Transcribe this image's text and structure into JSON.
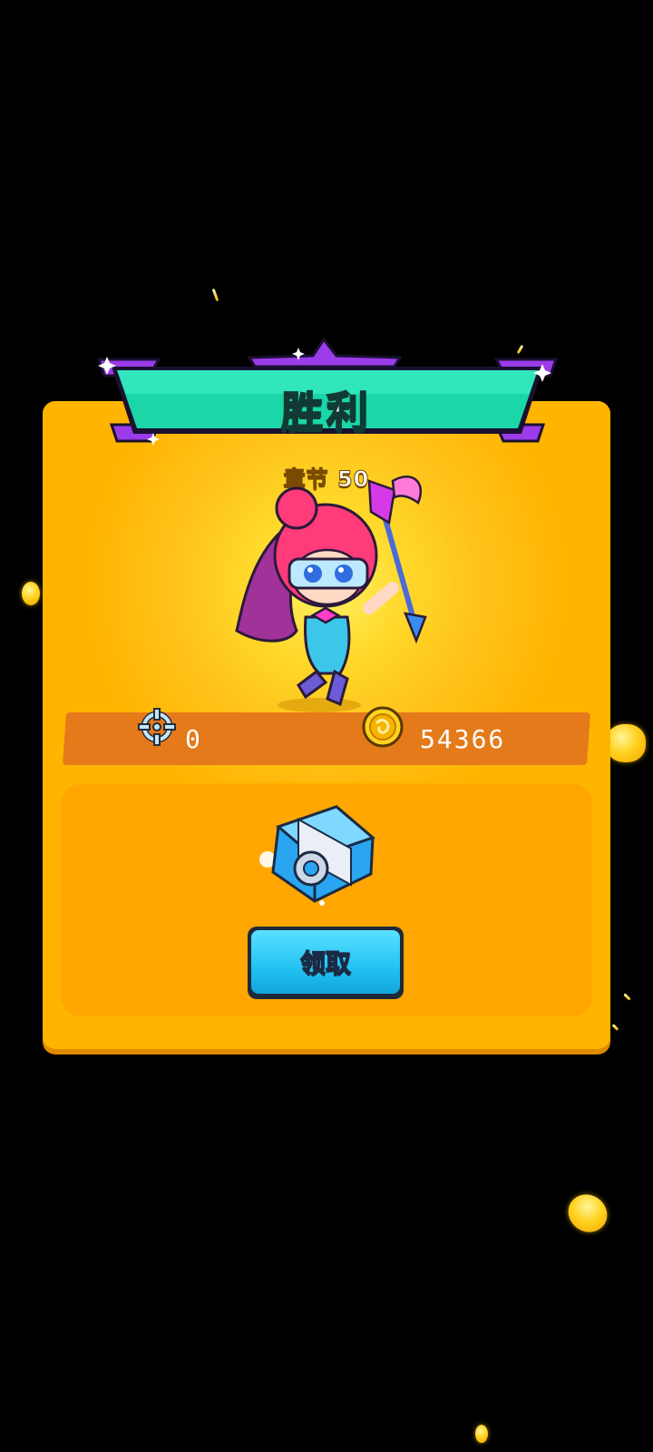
{
  "banner": {
    "title": "胜利"
  },
  "chapter": {
    "label": "章节",
    "number": "50"
  },
  "stats": {
    "kills": "0",
    "gold": "54366"
  },
  "reward": {
    "claim_label": "领取"
  },
  "colors": {
    "panel": "#ffb400",
    "banner": "#1bd6a8",
    "banner_trim": "#9b3bea",
    "stats_bar": "#e57a1a",
    "claim_button": "#22c2f2"
  },
  "icons": {
    "kills": "crosshair-icon",
    "gold": "gold-coin-icon",
    "reward": "blue-treasure-chest-icon"
  }
}
